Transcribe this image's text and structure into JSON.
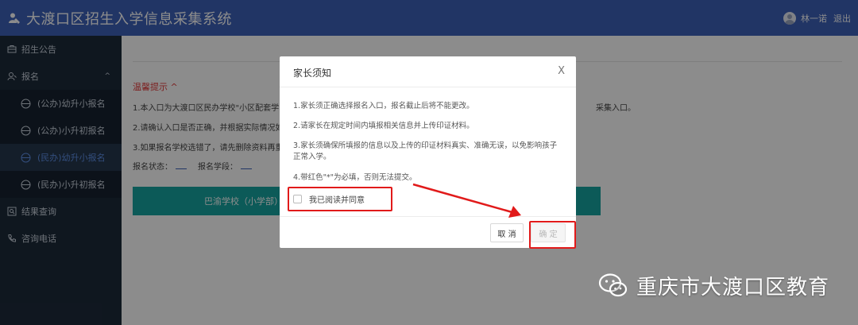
{
  "app": {
    "title": "大渡口区招生入学信息采集系统",
    "user_name": "林一诺",
    "logout_label": "退出"
  },
  "sidebar": {
    "items": [
      {
        "label": "招生公告",
        "icon": "notice-icon"
      },
      {
        "label": "报名",
        "icon": "signup-icon",
        "expanded": true
      },
      {
        "label": "(公办)幼升小报名",
        "icon": "globe-icon"
      },
      {
        "label": "(公办)小升初报名",
        "icon": "globe-icon"
      },
      {
        "label": "(民办)幼升小报名",
        "icon": "globe-icon",
        "active": true
      },
      {
        "label": "(民办)小升初报名",
        "icon": "globe-icon"
      },
      {
        "label": "结果查询",
        "icon": "search-icon"
      },
      {
        "label": "咨询电话",
        "icon": "phone-icon"
      }
    ]
  },
  "main": {
    "notice_heading": "温馨提示 ^",
    "line1": "1.本入口为大渡口区民办学校\"小区配套学",
    "line1_tail": "采集入口。",
    "line2": "2.请确认入口是否正确，并根据实际情况如",
    "line3": "3.如果报名学校选错了，请先删除资料再重",
    "status_label": "报名状态：",
    "stage_label": "报名学段：",
    "school_button": "巴渝学校（小学部）"
  },
  "dialog": {
    "title": "家长须知",
    "close": "X",
    "lines": [
      "1.家长须正确选择报名入口，报名截止后将不能更改。",
      "2.请家长在规定时间内填报相关信息并上传印证材料。",
      "3.家长须确保所填报的信息以及上传的印证材料真实、准确无误，以免影响孩子正常入学。",
      "4.带红色\"*\"为必填，否则无法提交。"
    ],
    "agree_label": "我已阅读并同意",
    "cancel_label": "取 消",
    "confirm_label": "确 定"
  },
  "watermark": {
    "text": "重庆市大渡口区教育"
  },
  "colors": {
    "topbar": "#3c61b8",
    "sidebar": "#1d2a3a",
    "accent": "#16a4a0",
    "highlight": "#e11a1a"
  }
}
